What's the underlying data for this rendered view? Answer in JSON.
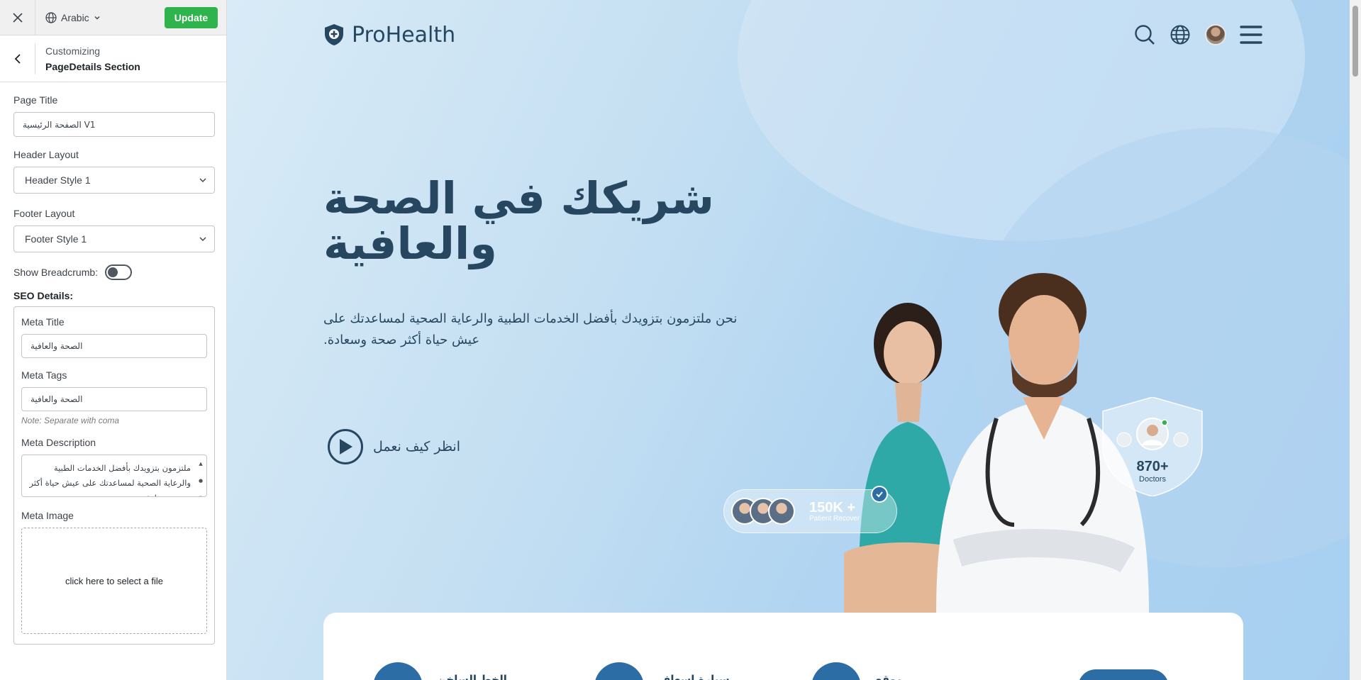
{
  "topbar": {
    "language": "Arabic",
    "update_label": "Update"
  },
  "section": {
    "sub": "Customizing",
    "title": "PageDetails Section"
  },
  "form": {
    "page_title_label": "Page Title",
    "page_title_value": "الصفحة الرئيسية V1",
    "header_layout_label": "Header Layout",
    "header_layout_value": "Header Style 1",
    "footer_layout_label": "Footer Layout",
    "footer_layout_value": "Footer Style 1",
    "breadcrumb_label": "Show Breadcrumb:",
    "breadcrumb_on": false,
    "seo_title": "SEO Details:",
    "meta_title_label": "Meta Title",
    "meta_title_value": "الصحة والعافية",
    "meta_tags_label": "Meta Tags",
    "meta_tags_value": "الصحة والعافية",
    "meta_tags_note": "Note: Separate with coma",
    "meta_desc_label": "Meta Description",
    "meta_desc_value": "ملتزمون بتزويدك بأفضل الخدمات الطبية والرعاية الصحية لمساعدتك على عيش حياة أكثر صحة وسعادة",
    "meta_image_label": "Meta Image",
    "meta_image_placeholder": "click here to select a file"
  },
  "site": {
    "brand": "ProHealth",
    "hero_title": "شريكك في الصحة والعافية",
    "hero_subtitle": "نحن ملتزمون بتزويدك بأفضل الخدمات الطبية والرعاية الصحية لمساعدتك على عيش حياة أكثر صحة وسعادة.",
    "video_label": "انظر كيف نعمل",
    "patients_count": "150K +",
    "patients_label": "Patient Recover",
    "doctors_count": "870+",
    "doctors_label": "Doctors",
    "info_items": [
      "الخط الساخن",
      "سيارة إسعاف",
      "موقع"
    ]
  },
  "colors": {
    "brand": "#274760",
    "accent": "#2d6da6",
    "update_button": "#2eb34d"
  },
  "icons": [
    "close-icon",
    "globe-icon",
    "chevron-down-icon",
    "back-arrow-icon",
    "shield-logo-icon",
    "search-icon",
    "menu-icon",
    "play-icon",
    "check-icon"
  ]
}
